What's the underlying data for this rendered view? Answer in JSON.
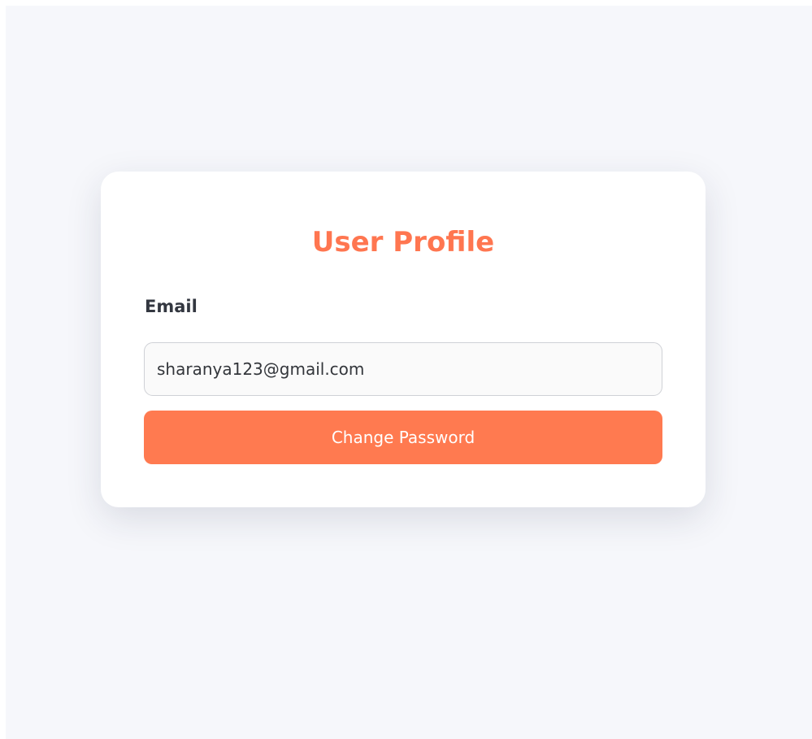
{
  "profile": {
    "title": "User Profile",
    "email_label": "Email",
    "email_value": "sharanya123@gmail.com",
    "change_password_label": "Change Password"
  },
  "colors": {
    "accent": "#ff7650",
    "button": "#ff7a50",
    "background": "#f6f7fb",
    "card": "#ffffff"
  }
}
